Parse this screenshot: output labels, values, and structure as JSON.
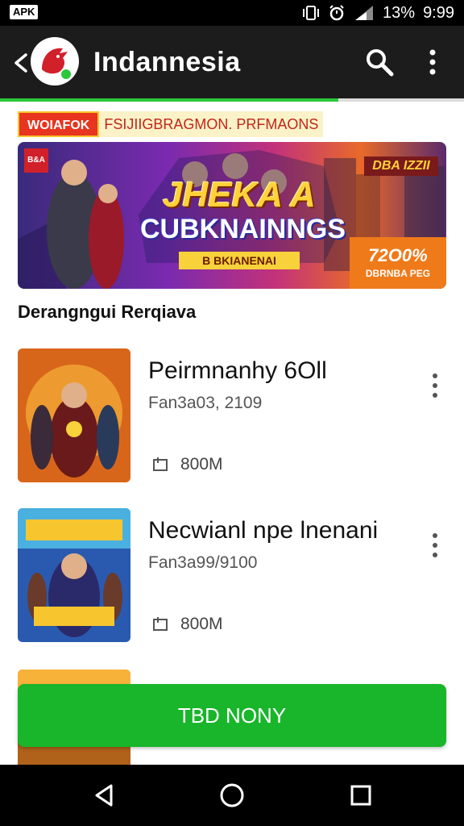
{
  "status_bar": {
    "badge": "APK",
    "battery_percent": "13%",
    "time": "9:99",
    "icons": [
      "vibrate-icon",
      "alarm-icon",
      "signal-icon"
    ]
  },
  "app_bar": {
    "title": "Indannesia",
    "icons": [
      "back-icon",
      "app-logo",
      "search-icon",
      "more-vert-icon"
    ],
    "loading_progress": 0.73
  },
  "promo": {
    "tag": "WOIAFOK",
    "text": "FSIJIIGBRAGMON. PRFMAONS"
  },
  "banner": {
    "title": "JHEKA A",
    "subtitle": "CUBKNAINNGS",
    "ribbon": "B BKIANENAI",
    "corner_label": "DBA IZZII",
    "small_badge": "B&A",
    "offer_value": "72O0%",
    "offer_label": "DBRNBA PEG"
  },
  "section": {
    "title": "Derangngui Rerqiava"
  },
  "list": [
    {
      "title": "Peirmnanhy 6Oll",
      "meta": "Fan3a03, 2109",
      "size": "800M"
    },
    {
      "title": "Necwianl npe lnenani",
      "meta": "Fan3a99/9100",
      "size": "800M"
    }
  ],
  "cta": {
    "label": "TBD NONY"
  },
  "colors": {
    "app_bar": "#1c1c1c",
    "accent_green": "#19b52a",
    "progress_green": "#2bc83a",
    "promo_red": "#e8351f"
  }
}
